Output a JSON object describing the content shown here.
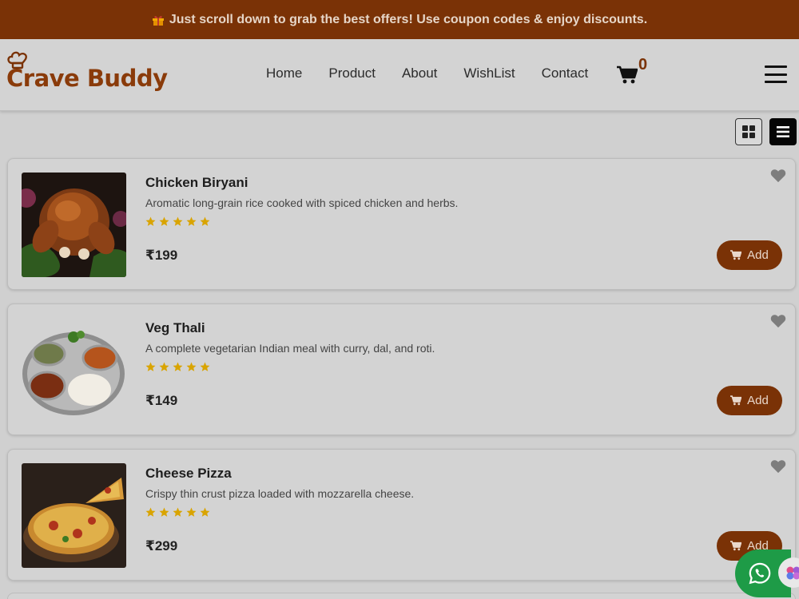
{
  "announcement": {
    "text": "Just scroll down to grab the best offers! Use coupon codes & enjoy discounts."
  },
  "brand": {
    "name": "Crave Buddy"
  },
  "nav": {
    "items": [
      "Home",
      "Product",
      "About",
      "WishList",
      "Contact"
    ]
  },
  "cart": {
    "count": "0"
  },
  "colors": {
    "accent": "#7a3206",
    "star": "#d9a400",
    "whatsapp": "#1e9b47"
  },
  "products": [
    {
      "name": "Chicken Biryani",
      "description": "Aromatic long-grain rice cooked with spiced chicken and herbs.",
      "rating": 5,
      "price": "₹199",
      "add_label": "Add",
      "image": "roast-chicken-image"
    },
    {
      "name": "Veg Thali",
      "description": "A complete vegetarian Indian meal with curry, dal, and roti.",
      "rating": 5,
      "price": "₹149",
      "add_label": "Add",
      "image": "veg-thali-image"
    },
    {
      "name": "Cheese Pizza",
      "description": "Crispy thin crust pizza loaded with mozzarella cheese.",
      "rating": 5,
      "price": "₹299",
      "add_label": "Add",
      "image": "cheese-pizza-image"
    }
  ]
}
